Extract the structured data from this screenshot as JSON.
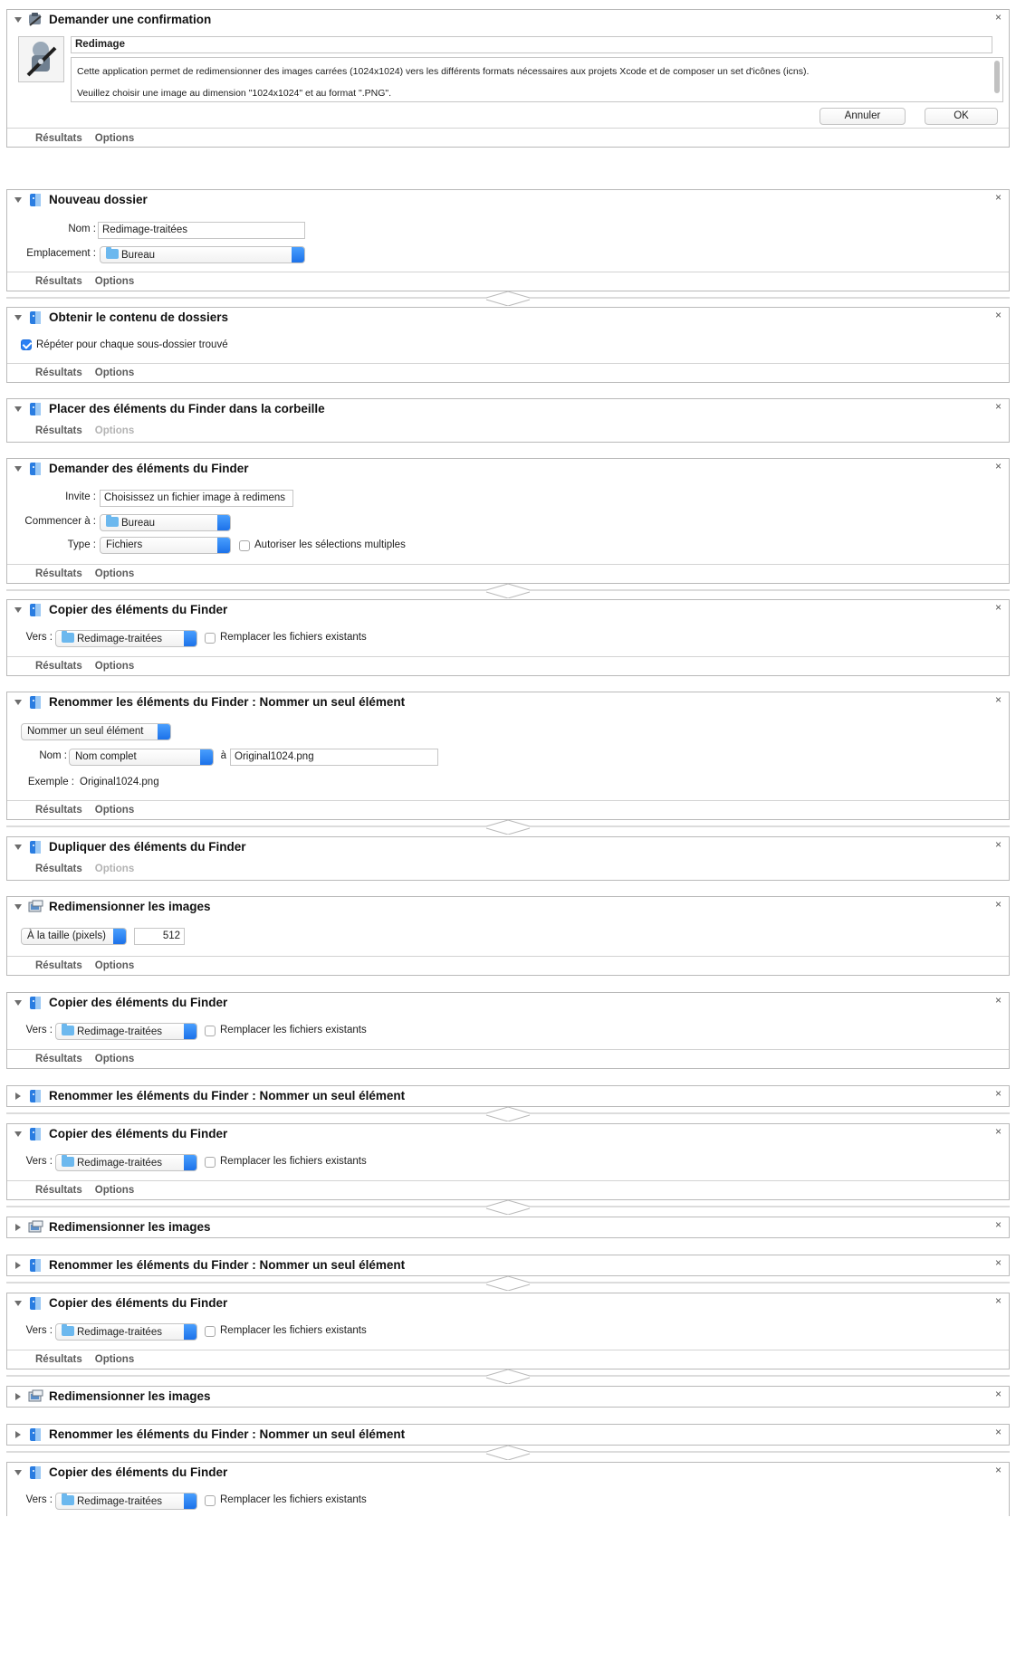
{
  "labels": {
    "results": "Résultats",
    "options": "Options",
    "close": "×"
  },
  "confirm": {
    "title": "Demander une confirmation",
    "heading": "Redimage",
    "message_line1": "Cette application permet de redimensionner des images carrées (1024x1024) vers les différents formats nécessaires aux projets Xcode et de composer un set d'icônes (icns).",
    "message_line2": "Veuillez choisir une image au dimension \"1024x1024\" et au format \".PNG\".",
    "cancel_label": "Annuler",
    "ok_label": "OK"
  },
  "new_folder": {
    "title": "Nouveau dossier",
    "name_label": "Nom :",
    "name_value": "Redimage-traitées",
    "location_label": "Emplacement :",
    "location_value": "Bureau"
  },
  "get_folder_contents": {
    "title": "Obtenir le contenu de dossiers",
    "repeat_label": "Répéter pour chaque sous-dossier trouvé",
    "repeat_checked": true
  },
  "trash": {
    "title": "Placer des éléments du Finder dans la corbeille"
  },
  "ask_finder": {
    "title": "Demander des éléments du Finder",
    "prompt_label": "Invite :",
    "prompt_value": "Choisissez un fichier image à redimens",
    "start_label": "Commencer à :",
    "start_value": "Bureau",
    "type_label": "Type :",
    "type_value": "Fichiers",
    "multi_label": "Autoriser les sélections multiples"
  },
  "copy": {
    "title": "Copier des éléments du Finder",
    "to_label": "Vers :",
    "to_value": "Redimage-traitées",
    "replace_label": "Remplacer les fichiers existants"
  },
  "rename": {
    "title": "Renommer les éléments du Finder : Nommer un seul élément",
    "mode_value": "Nommer un seul élément",
    "name_label": "Nom :",
    "name_mode": "Nom complet",
    "to_label": "à",
    "new_name": "Original1024.png",
    "example_label": "Exemple :",
    "example_value": "Original1024.png"
  },
  "duplicate": {
    "title": "Dupliquer des éléments du Finder"
  },
  "resize": {
    "title": "Redimensionner les images",
    "mode_value": "À la taille (pixels)",
    "size_value": "512"
  }
}
